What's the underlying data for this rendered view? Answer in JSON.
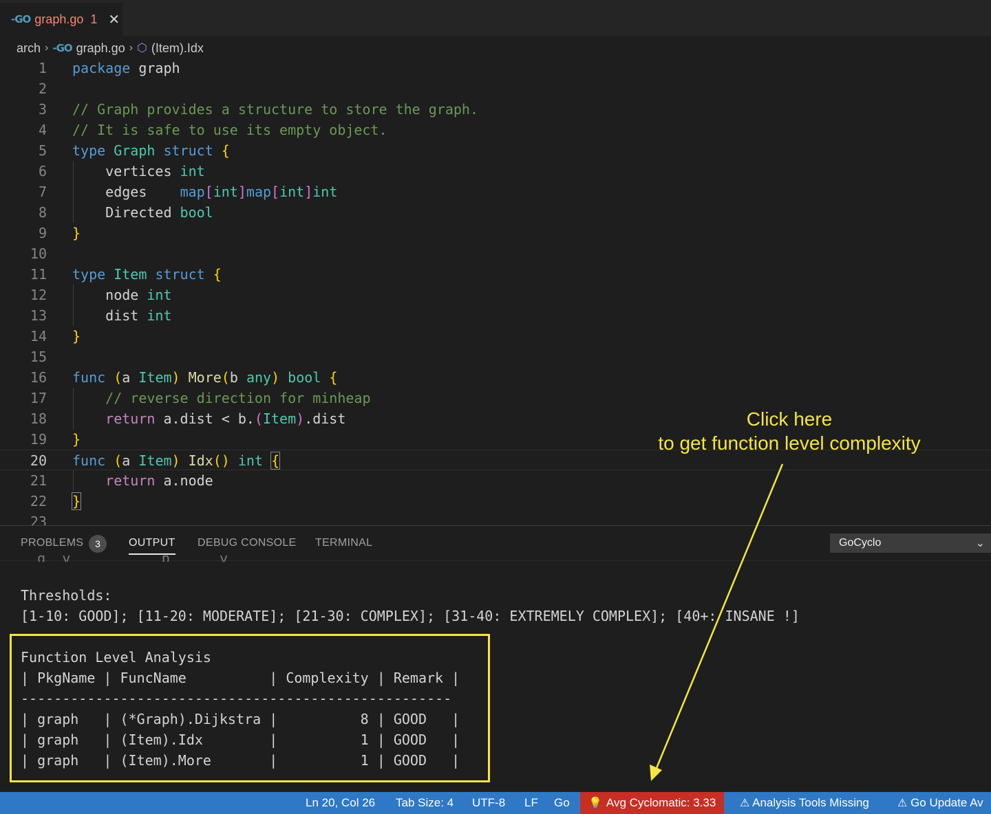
{
  "tab": {
    "icon": "go-icon",
    "name": "graph.go",
    "badge": "1",
    "close": "✕"
  },
  "breadcrumb": {
    "folder": "arch",
    "file": "graph.go",
    "symbol": "(Item).Idx"
  },
  "editor": {
    "active_line": 20,
    "line_numbers": [
      "1",
      "2",
      "3",
      "4",
      "5",
      "6",
      "7",
      "8",
      "9",
      "10",
      "11",
      "12",
      "13",
      "14",
      "15",
      "16",
      "17",
      "18",
      "19",
      "20",
      "21",
      "22",
      "23"
    ]
  },
  "panel": {
    "tabs": {
      "problems": "PROBLEMS",
      "problems_count": "3",
      "output": "OUTPUT",
      "debug": "DEBUG CONSOLE",
      "terminal": "TERMINAL"
    },
    "channel": "GoCyclo",
    "output_lines": [
      "Thresholds:",
      "[1-10: GOOD]; [11-20: MODERATE]; [21-30: COMPLEX]; [31-40: EXTREMELY COMPLEX]; [40+: INSANE !]",
      "",
      "Function Level Analysis",
      "| PkgName | FuncName          | Complexity | Remark |",
      "----------------------------------------------------",
      "| graph   | (*Graph).Dijkstra |          8 | GOOD   |",
      "| graph   | (Item).Idx        |          1 | GOOD   |",
      "| graph   | (Item).More       |          1 | GOOD   |"
    ]
  },
  "annotation": {
    "line1": "Click here",
    "line2": "to get function level complexity",
    "color": "#f5e642"
  },
  "status": {
    "position": "Ln 20, Col 26",
    "tab_size": "Tab Size: 4",
    "encoding": "UTF-8",
    "eol": "LF",
    "language": "Go",
    "cyclomatic": "Avg Cyclomatic: 3.33",
    "analysis": "Analysis Tools Missing",
    "update": "Go Update Av",
    "bg": "#2f78c5",
    "cyclo_bg": "#c72e24"
  }
}
